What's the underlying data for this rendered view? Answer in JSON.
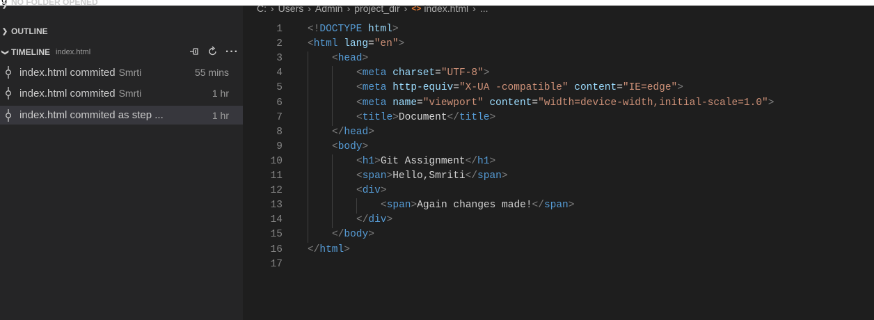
{
  "sidebar": {
    "no_folder_label": "NO FOLDER OPENED",
    "outline_label": "OUTLINE",
    "timeline": {
      "label": "TIMELINE",
      "file": "index.html",
      "actions": [
        "pin-icon",
        "refresh-icon",
        "more-icon"
      ],
      "items": [
        {
          "message": "index.html commited",
          "author": "Smrti",
          "time": "55 mins",
          "selected": false
        },
        {
          "message": "index.html commited",
          "author": "Smrti",
          "time": "1 hr",
          "selected": false
        },
        {
          "message": "index.html commited as step ...",
          "author": "",
          "time": "1 hr",
          "selected": true
        }
      ]
    }
  },
  "top_partial_text": "g",
  "breadcrumb": {
    "parts": [
      "C:",
      "Users",
      "Admin",
      "project_dir",
      "index.html",
      "..."
    ],
    "file_icon": "html-icon"
  },
  "editor": {
    "lines": [
      {
        "n": "1",
        "indent": 0,
        "tokens": [
          [
            "p",
            "<!"
          ],
          [
            "tag",
            "DOCTYPE"
          ],
          [
            "text",
            " "
          ],
          [
            "attr",
            "html"
          ],
          [
            "p",
            ">"
          ]
        ]
      },
      {
        "n": "2",
        "indent": 0,
        "tokens": [
          [
            "p",
            "<"
          ],
          [
            "tag",
            "html"
          ],
          [
            "text",
            " "
          ],
          [
            "attr",
            "lang"
          ],
          [
            "text",
            "="
          ],
          [
            "str",
            "\"en\""
          ],
          [
            "p",
            ">"
          ]
        ]
      },
      {
        "n": "3",
        "indent": 1,
        "tokens": [
          [
            "p",
            "<"
          ],
          [
            "tag",
            "head"
          ],
          [
            "p",
            ">"
          ]
        ]
      },
      {
        "n": "4",
        "indent": 2,
        "tokens": [
          [
            "p",
            "<"
          ],
          [
            "tag",
            "meta"
          ],
          [
            "text",
            " "
          ],
          [
            "attr",
            "charset"
          ],
          [
            "text",
            "="
          ],
          [
            "str",
            "\"UTF-8\""
          ],
          [
            "p",
            ">"
          ]
        ]
      },
      {
        "n": "5",
        "indent": 2,
        "tokens": [
          [
            "p",
            "<"
          ],
          [
            "tag",
            "meta"
          ],
          [
            "text",
            " "
          ],
          [
            "attr",
            "http-equiv"
          ],
          [
            "text",
            "="
          ],
          [
            "str",
            "\"X-UA -compatible\""
          ],
          [
            "text",
            " "
          ],
          [
            "attr",
            "content"
          ],
          [
            "text",
            "="
          ],
          [
            "str",
            "\"IE=edge\""
          ],
          [
            "p",
            ">"
          ]
        ]
      },
      {
        "n": "6",
        "indent": 2,
        "tokens": [
          [
            "p",
            "<"
          ],
          [
            "tag",
            "meta"
          ],
          [
            "text",
            " "
          ],
          [
            "attr",
            "name"
          ],
          [
            "text",
            "="
          ],
          [
            "str",
            "\"viewport\""
          ],
          [
            "text",
            " "
          ],
          [
            "attr",
            "content"
          ],
          [
            "text",
            "="
          ],
          [
            "str",
            "\"width=device-width,initial-scale=1.0\""
          ],
          [
            "p",
            ">"
          ]
        ]
      },
      {
        "n": "7",
        "indent": 2,
        "tokens": [
          [
            "p",
            "<"
          ],
          [
            "tag",
            "title"
          ],
          [
            "p",
            ">"
          ],
          [
            "text",
            "Document"
          ],
          [
            "p",
            "</"
          ],
          [
            "tag",
            "title"
          ],
          [
            "p",
            ">"
          ]
        ]
      },
      {
        "n": "8",
        "indent": 1,
        "tokens": [
          [
            "p",
            "</"
          ],
          [
            "tag",
            "head"
          ],
          [
            "p",
            ">"
          ]
        ]
      },
      {
        "n": "9",
        "indent": 1,
        "tokens": [
          [
            "p",
            "<"
          ],
          [
            "tag",
            "body"
          ],
          [
            "p",
            ">"
          ]
        ]
      },
      {
        "n": "10",
        "indent": 2,
        "tokens": [
          [
            "p",
            "<"
          ],
          [
            "tag",
            "h1"
          ],
          [
            "p",
            ">"
          ],
          [
            "text",
            "Git Assignment"
          ],
          [
            "p",
            "</"
          ],
          [
            "tag",
            "h1"
          ],
          [
            "p",
            ">"
          ]
        ]
      },
      {
        "n": "11",
        "indent": 2,
        "tokens": [
          [
            "p",
            "<"
          ],
          [
            "tag",
            "span"
          ],
          [
            "p",
            ">"
          ],
          [
            "text",
            "Hello,Smriti"
          ],
          [
            "p",
            "</"
          ],
          [
            "tag",
            "span"
          ],
          [
            "p",
            ">"
          ]
        ]
      },
      {
        "n": "12",
        "indent": 2,
        "tokens": [
          [
            "p",
            "<"
          ],
          [
            "tag",
            "div"
          ],
          [
            "p",
            ">"
          ]
        ]
      },
      {
        "n": "13",
        "indent": 3,
        "tokens": [
          [
            "p",
            "<"
          ],
          [
            "tag",
            "span"
          ],
          [
            "p",
            ">"
          ],
          [
            "text",
            "Again changes made!"
          ],
          [
            "p",
            "</"
          ],
          [
            "tag",
            "span"
          ],
          [
            "p",
            ">"
          ]
        ]
      },
      {
        "n": "14",
        "indent": 2,
        "tokens": [
          [
            "p",
            "</"
          ],
          [
            "tag",
            "div"
          ],
          [
            "p",
            ">"
          ]
        ]
      },
      {
        "n": "15",
        "indent": 1,
        "tokens": [
          [
            "p",
            "</"
          ],
          [
            "tag",
            "body"
          ],
          [
            "p",
            ">"
          ]
        ]
      },
      {
        "n": "16",
        "indent": 0,
        "tokens": [
          [
            "p",
            "</"
          ],
          [
            "tag",
            "html"
          ],
          [
            "p",
            ">"
          ]
        ]
      },
      {
        "n": "17",
        "indent": 0,
        "tokens": []
      }
    ]
  },
  "colors": {
    "sidebar_bg": "#252526",
    "editor_bg": "#1e1e1e",
    "selected_row": "#37373d",
    "tag": "#569cd6",
    "attr": "#9cdcfe",
    "string": "#ce9178",
    "punct": "#808080",
    "line_number": "#858585"
  }
}
